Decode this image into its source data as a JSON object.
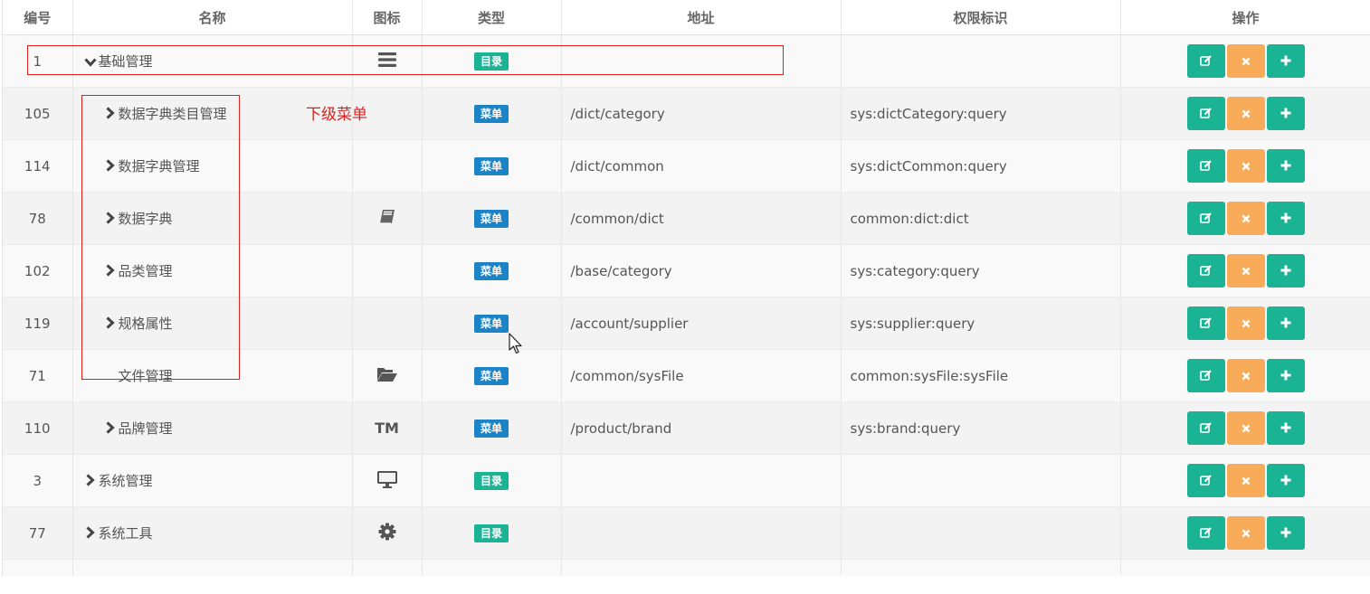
{
  "columns": [
    "编号",
    "名称",
    "图标",
    "类型",
    "地址",
    "权限标识",
    "操作"
  ],
  "rows": [
    {
      "id": "1",
      "name": "基础管理",
      "level": 0,
      "expand": "down",
      "icon": "bars-icon",
      "type": "目录",
      "type_kind": "dir",
      "url": "",
      "perm": ""
    },
    {
      "id": "105",
      "name": "数据字典类目管理",
      "level": 1,
      "expand": "right",
      "icon": "",
      "type": "菜单",
      "type_kind": "menu",
      "url": "/dict/category",
      "perm": "sys:dictCategory:query"
    },
    {
      "id": "114",
      "name": "数据字典管理",
      "level": 1,
      "expand": "right",
      "icon": "",
      "type": "菜单",
      "type_kind": "menu",
      "url": "/dict/common",
      "perm": "sys:dictCommon:query"
    },
    {
      "id": "78",
      "name": "数据字典",
      "level": 1,
      "expand": "right",
      "icon": "book-icon",
      "type": "菜单",
      "type_kind": "menu",
      "url": "/common/dict",
      "perm": "common:dict:dict"
    },
    {
      "id": "102",
      "name": "品类管理",
      "level": 1,
      "expand": "right",
      "icon": "",
      "type": "菜单",
      "type_kind": "menu",
      "url": "/base/category",
      "perm": "sys:category:query"
    },
    {
      "id": "119",
      "name": "规格属性",
      "level": 1,
      "expand": "right",
      "icon": "",
      "type": "菜单",
      "type_kind": "menu",
      "url": "/account/supplier",
      "perm": "sys:supplier:query"
    },
    {
      "id": "71",
      "name": "文件管理",
      "level": 1,
      "expand": "none",
      "icon": "folder-open-icon",
      "type": "菜单",
      "type_kind": "menu",
      "url": "/common/sysFile",
      "perm": "common:sysFile:sysFile"
    },
    {
      "id": "110",
      "name": "品牌管理",
      "level": 1,
      "expand": "right",
      "icon": "trademark-icon",
      "type": "菜单",
      "type_kind": "menu",
      "url": "/product/brand",
      "perm": "sys:brand:query"
    },
    {
      "id": "3",
      "name": "系统管理",
      "level": 0,
      "expand": "right",
      "icon": "monitor-icon",
      "type": "目录",
      "type_kind": "dir",
      "url": "",
      "perm": ""
    },
    {
      "id": "77",
      "name": "系统工具",
      "level": 0,
      "expand": "right",
      "icon": "gear-icon",
      "type": "目录",
      "type_kind": "dir",
      "url": "",
      "perm": ""
    },
    {
      "id": "",
      "name": "",
      "level": 0,
      "expand": "none",
      "icon": "",
      "type": "",
      "type_kind": "",
      "url": "",
      "perm": ""
    }
  ],
  "annotation": {
    "label": "下级菜单",
    "color": "#e0201c"
  },
  "icon_glyphs": {
    "trademark-icon": "TM"
  },
  "colors": {
    "dir_badge": "#1ab394",
    "menu_badge": "#1c84c6",
    "edit_btn": "#1ab394",
    "delete_btn": "#f8ac59",
    "add_btn": "#1ab394"
  }
}
